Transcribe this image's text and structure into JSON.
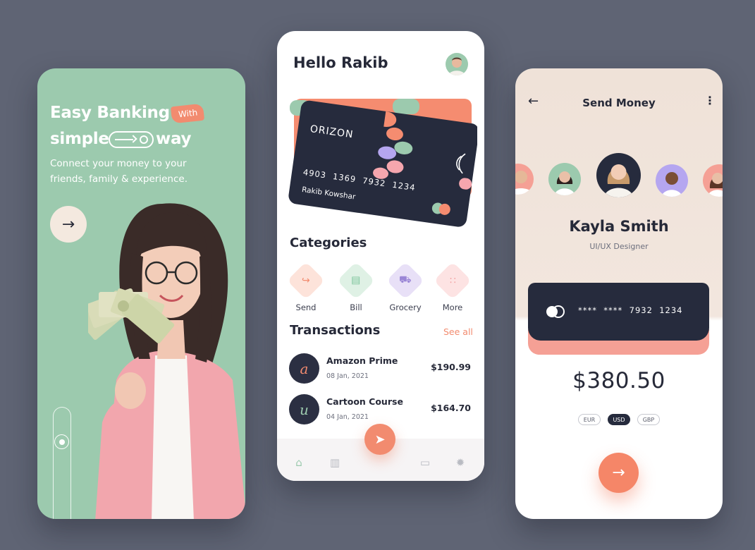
{
  "colors": {
    "background": "#5f6474",
    "mint": "#9ccaae",
    "coral": "#f28b6f",
    "navy": "#262b3d",
    "cream": "#efe2d8"
  },
  "onboarding": {
    "title_line1": "Easy Banking",
    "with_tag": "With",
    "title_simple": "simple",
    "title_way": "way",
    "subtitle": "Connect your money to your friends, family & experience.",
    "next_icon": "arrow-right-icon"
  },
  "home": {
    "greeting": "Hello Rakib",
    "card": {
      "brand": "ORIZON",
      "number": "4903  1369  7932  1234",
      "holder": "Rakib Kowshar"
    },
    "categories_title": "Categories",
    "categories": [
      {
        "label": "Send",
        "icon": "send-money-icon",
        "color": "#fde3da",
        "ink": "#f28b6f"
      },
      {
        "label": "Bill",
        "icon": "bill-icon",
        "color": "#dff1e5",
        "ink": "#7cc59b"
      },
      {
        "label": "Grocery",
        "icon": "cart-icon",
        "color": "#e8e0f7",
        "ink": "#9a86d6"
      },
      {
        "label": "More",
        "icon": "more-grid-icon",
        "color": "#fde3e3",
        "ink": "#f3a2a2"
      }
    ],
    "transactions_title": "Transactions",
    "see_all": "See all",
    "transactions": [
      {
        "name": "Amazon Prime",
        "date": "08 Jan, 2021",
        "amount": "$190.99",
        "logo": "a"
      },
      {
        "name": "Cartoon Course",
        "date": "04 Jan, 2021",
        "amount": "$164.70",
        "logo": "u"
      }
    ],
    "tabs": [
      "home-icon",
      "stats-icon",
      "chat-icon",
      "settings-icon"
    ]
  },
  "send": {
    "title": "Send Money",
    "recipient_name": "Kayla Smith",
    "recipient_role": "UI/UX Designer",
    "card_number": "****  ****  7932  1234",
    "amount": "$380.50",
    "currencies": [
      "EUR",
      "USD",
      "GBP"
    ],
    "selected_currency": "USD"
  }
}
